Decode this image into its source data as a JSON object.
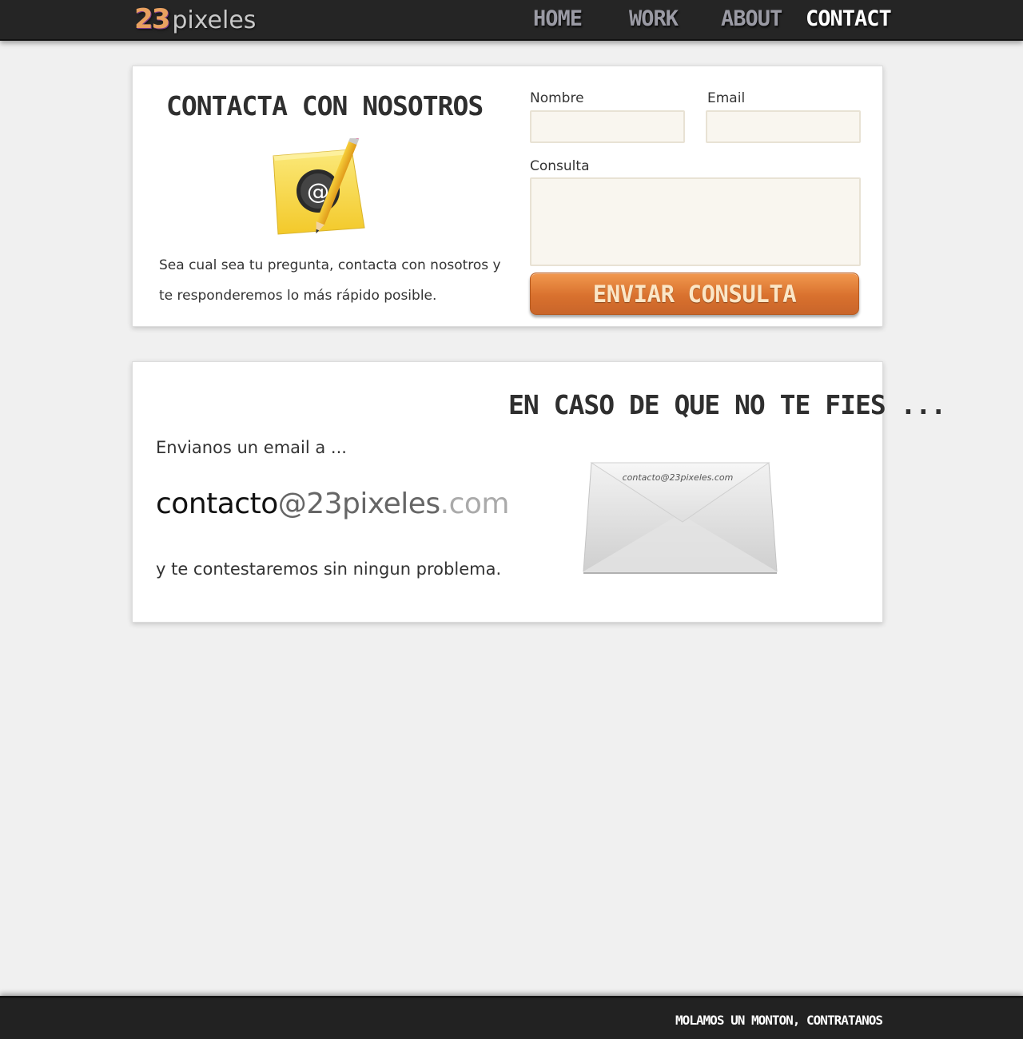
{
  "header": {
    "logo_number": "23",
    "logo_word": "pixeles",
    "nav": [
      {
        "label": "HOME",
        "active": false
      },
      {
        "label": "WORK",
        "active": false
      },
      {
        "label": "ABOUT",
        "active": false
      },
      {
        "label": "CONTACT",
        "active": true
      }
    ]
  },
  "contact_panel": {
    "title": "CONTACTA CON NOSOTROS",
    "icon": "address-book-pencil-icon",
    "intro": "Sea cual sea tu pregunta, contacta con nosotros y te responderemos lo más rápido posible.",
    "form": {
      "name_label": "Nombre",
      "name_value": "",
      "email_label": "Email",
      "email_value": "",
      "query_label": "Consulta",
      "query_value": "",
      "submit_label": "ENVIAR CONSULTA"
    }
  },
  "email_panel": {
    "title": "EN CASO DE QUE NO TE FIES ...",
    "line1": "Envianos un email a ...",
    "email_user": "contacto",
    "email_domain": "@23pixeles",
    "email_tld": ".com",
    "line3": "y te contestaremos sin ningun problema.",
    "envelope_text": "contacto@23pixeles.com",
    "icon": "envelope-icon"
  },
  "footer": {
    "text": "MOLAMOS UN MONTON, CONTRATANOS"
  },
  "colors": {
    "accent": "#d9712e",
    "header_bg": "#252525",
    "page_bg": "#f0f0f0",
    "input_bg": "#f9f6ef"
  }
}
